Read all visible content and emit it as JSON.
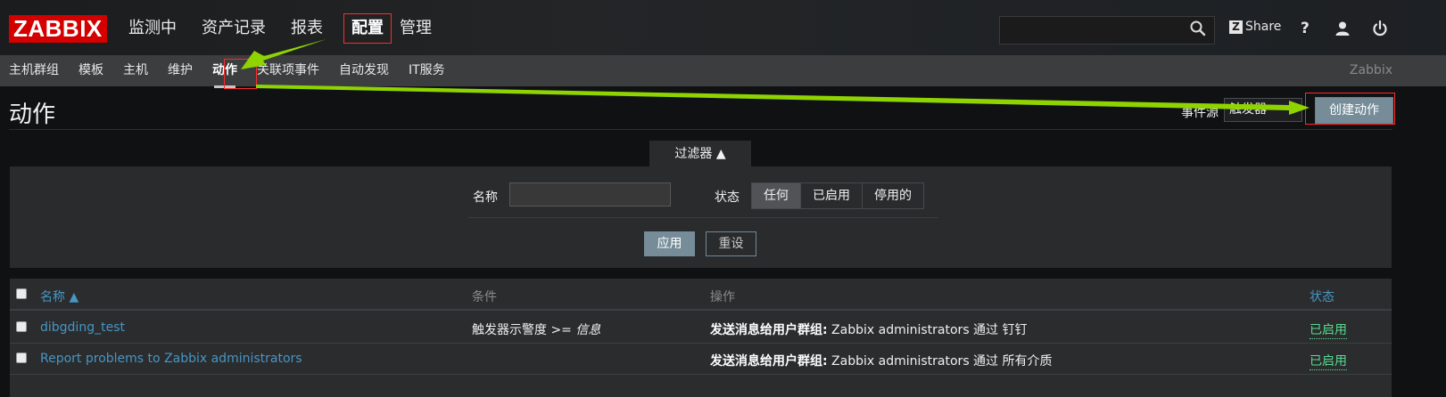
{
  "logo": "ZABBIX",
  "main_menu": [
    "监测中",
    "资产记录",
    "报表",
    "配置",
    "管理"
  ],
  "header": {
    "search_value": "",
    "share_label": "Share",
    "share_badge": "Z",
    "help_label": "?"
  },
  "sub_menu": [
    "主机群组",
    "模板",
    "主机",
    "维护",
    "动作",
    "关联项事件",
    "自动发现",
    "IT服务"
  ],
  "sub_menu_right": "Zabbix",
  "page": {
    "title": "动作",
    "event_source_label": "事件源",
    "event_source_value": "触发器",
    "create_button": "创建动作"
  },
  "filter": {
    "tab_label": "过滤器 ▲",
    "name_label": "名称",
    "name_value": "",
    "status_label": "状态",
    "status_options": [
      "任何",
      "已启用",
      "停用的"
    ],
    "status_selected": "任何",
    "apply": "应用",
    "reset": "重设"
  },
  "table": {
    "headers": {
      "name": "名称 ▲",
      "conditions": "条件",
      "operations": "操作",
      "status": "状态"
    },
    "rows": [
      {
        "name": "dibgding_test",
        "condition_main": "触发器示警度 >= ",
        "condition_value": "信息",
        "op_bold": "发送消息给用户群组:",
        "op_text": " Zabbix administrators 通过 钉钉",
        "status": "已启用"
      },
      {
        "name": "Report problems to Zabbix administrators",
        "condition_main": "",
        "condition_value": "",
        "op_bold": "发送消息给用户群组:",
        "op_text": " Zabbix administrators 通过 所有介质",
        "status": "已启用"
      }
    ]
  },
  "colors": {
    "accent_red": "#d40000",
    "annotation_red": "#ff2b2b",
    "annotation_arrow": "#8fd400",
    "link": "#4796c4",
    "enabled": "#59db8f",
    "button": "#768d99"
  },
  "icons": [
    "search-icon",
    "help-icon",
    "user-icon",
    "power-icon",
    "checkbox-icon"
  ]
}
